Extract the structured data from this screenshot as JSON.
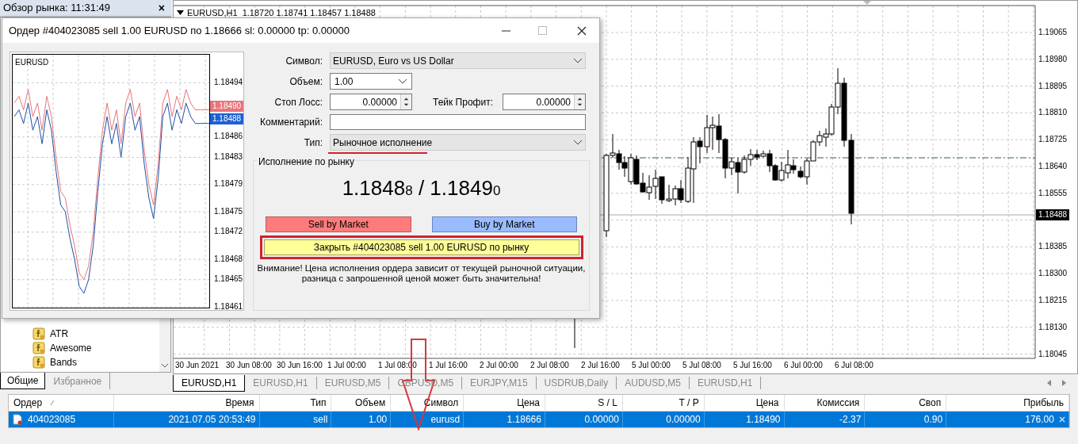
{
  "market_watch": {
    "title": "Обзор рынка: 11:31:49",
    "close": "×"
  },
  "navigator": {
    "items": [
      {
        "label": "ATR"
      },
      {
        "label": "Awesome"
      },
      {
        "label": "Bands"
      }
    ],
    "tabs": [
      {
        "label": "Общие",
        "selected": true
      },
      {
        "label": "Избранное",
        "selected": false
      }
    ]
  },
  "chart": {
    "header": "EURUSD,H1  1.18720 1.18741 1.18457 1.18488",
    "price_tag": "1.18488",
    "y_labels": [
      "1.19065",
      "1.18980",
      "1.18895",
      "1.18810",
      "1.18725",
      "1.18640",
      "1.18555",
      "1.18385",
      "1.18300",
      "1.18215",
      "1.18130",
      "1.18045"
    ],
    "x_labels": [
      "30 Jun 2021",
      "30 Jun 08:00",
      "30 Jun 16:00",
      "1 Jul 00:00",
      "1 Jul 08:00",
      "1 Jul 16:00",
      "2 Jul 00:00",
      "2 Jul 08:00",
      "2 Jul 16:00",
      "5 Jul 00:00",
      "5 Jul 08:00",
      "5 Jul 16:00",
      "6 Jul 00:00",
      "6 Jul 08:00"
    ]
  },
  "chart_tabs": [
    {
      "label": "EURUSD,H1",
      "selected": true
    },
    {
      "label": "EURUSD,H1",
      "selected": false
    },
    {
      "label": "EURUSD,M5",
      "selected": false
    },
    {
      "label": "GBPUSD,M5",
      "selected": false
    },
    {
      "label": "EURJPY,M15",
      "selected": false
    },
    {
      "label": "USDRUB,Daily",
      "selected": false
    },
    {
      "label": "AUDUSD,M5",
      "selected": false
    },
    {
      "label": "EURUSD,H1",
      "selected": false
    }
  ],
  "order_dialog": {
    "title": "Ордер #404023085 sell 1.00 EURUSD по 1.18666 sl: 0.00000 tp: 0.00000",
    "mini_chart": {
      "symbol": "EURUSD",
      "ask_tag": "1.18490",
      "bid_tag": "1.18488",
      "chart_data": {
        "type": "line",
        "grid": true,
        "ylim": [
          1.18461,
          1.18498
        ],
        "yticks": [
          {
            "value": 1.18494,
            "label": "1.18494"
          },
          {
            "value": 1.18486,
            "label": "1.18486"
          },
          {
            "value": 1.18483,
            "label": "1.18483"
          },
          {
            "value": 1.18479,
            "label": "1.18479"
          },
          {
            "value": 1.18475,
            "label": "1.18475"
          },
          {
            "value": 1.18472,
            "label": "1.18472"
          },
          {
            "value": 1.18468,
            "label": "1.18468"
          },
          {
            "value": 1.18465,
            "label": "1.18465"
          },
          {
            "value": 1.18461,
            "label": "1.18461"
          }
        ],
        "series": [
          {
            "color": "#e8757a",
            "values": [
              1.18491,
              1.18492,
              1.1849,
              1.18493,
              1.18489,
              1.18491,
              1.18487,
              1.18492,
              1.18489,
              1.18483,
              1.18478,
              1.18477,
              1.18473,
              1.1847,
              1.18466,
              1.18465,
              1.18467,
              1.18472,
              1.1848,
              1.18487,
              1.18491,
              1.18487,
              1.1849,
              1.18485,
              1.18491,
              1.18493,
              1.18489,
              1.18491,
              1.18484,
              1.18479,
              1.18476,
              1.18482,
              1.18491,
              1.18493,
              1.18489,
              1.18492,
              1.1849,
              1.18493,
              1.18491,
              1.1849,
              1.1849,
              1.1849,
              1.1849
            ]
          },
          {
            "color": "#1e4fa8",
            "values": [
              1.18489,
              1.1849,
              1.18488,
              1.18491,
              1.18487,
              1.18489,
              1.18485,
              1.1849,
              1.18487,
              1.18481,
              1.18476,
              1.18475,
              1.18471,
              1.18468,
              1.18464,
              1.18463,
              1.18465,
              1.1847,
              1.18478,
              1.18485,
              1.18489,
              1.18485,
              1.18488,
              1.18483,
              1.18489,
              1.18491,
              1.18487,
              1.18489,
              1.18482,
              1.18477,
              1.18474,
              1.1848,
              1.18489,
              1.18491,
              1.18487,
              1.1849,
              1.18488,
              1.18491,
              1.18489,
              1.18488,
              1.18488,
              1.18488,
              1.18488
            ]
          }
        ]
      }
    },
    "symbol": {
      "label": "Символ:",
      "value": "EURUSD, Euro vs US Dollar"
    },
    "volume": {
      "label": "Объем:",
      "value": "1.00"
    },
    "stop_loss": {
      "label": "Стоп Лосс:",
      "value": "0.00000"
    },
    "take_profit": {
      "label": "Тейк Профит:",
      "value": "0.00000"
    },
    "comment": {
      "label": "Комментарий:"
    },
    "type": {
      "label": "Тип:",
      "value": "Рыночное исполнение"
    },
    "group_title": "Исполнение по рынку",
    "quote": {
      "bid_main": "1.1848",
      "bid_small": "8",
      "separator": "/",
      "ask_main": "1.1849",
      "ask_small": "0"
    },
    "sell_button": "Sell by Market",
    "buy_button": "Buy by Market",
    "close_button": "Закрыть #404023085 sell 1.00 EURUSD по рынку",
    "warning": "Внимание! Цена исполнения ордера зависит от текущей рыночной ситуации,\nразница с запрошенной ценой может быть значительна!"
  },
  "terminal": {
    "columns": [
      "Ордер",
      "Время",
      "Тип",
      "Объем",
      "Символ",
      "Цена",
      "S / L",
      "T / P",
      "Цена",
      "Комиссия",
      "Своп",
      "Прибыль"
    ],
    "rows": [
      {
        "selected": true,
        "cells": [
          "404023085",
          "2021.07.05 20:53:49",
          "sell",
          "1.00",
          "eurusd",
          "1.18666",
          "0.00000",
          "0.00000",
          "1.18490",
          "-2.37",
          "0.90",
          "176.00"
        ]
      }
    ]
  }
}
